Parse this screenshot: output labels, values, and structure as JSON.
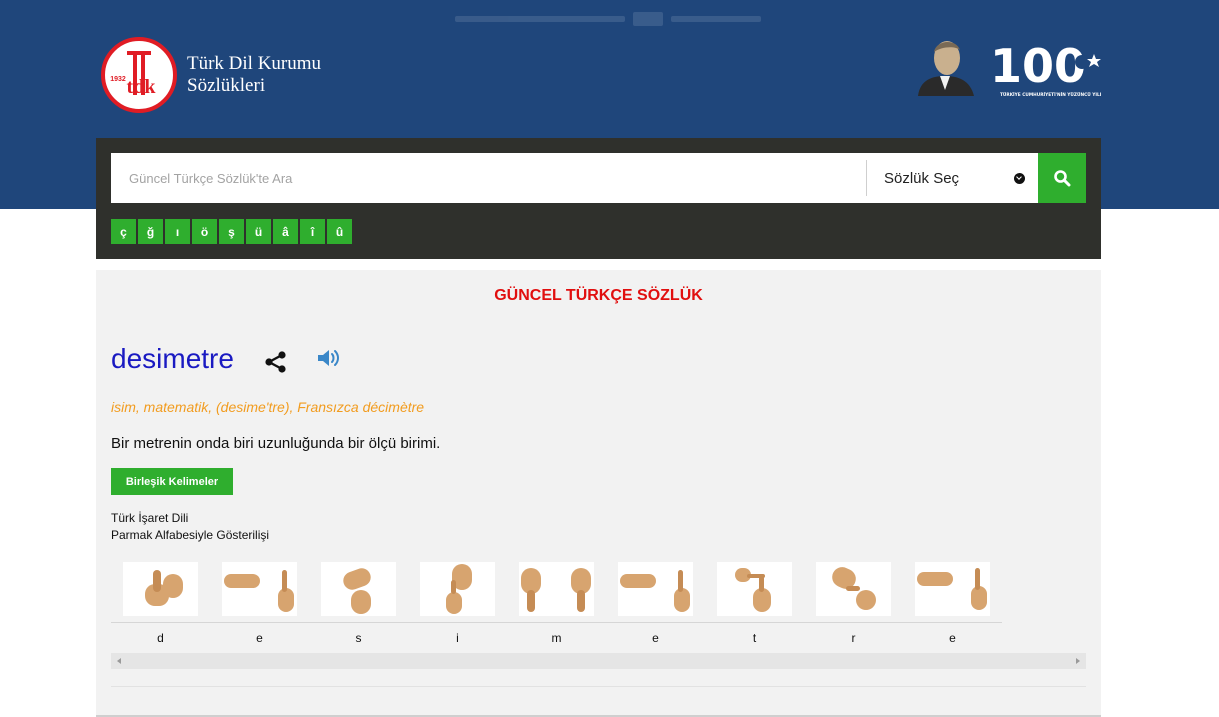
{
  "brand": {
    "name_line1": "Türk Dil Kurumu",
    "name_line2": "Sözlükleri",
    "logo_year": "1932",
    "logo_letters": "tdk",
    "centenary_number": "100",
    "centenary_caption": "TÜRKİYE CUMHURİYETİ'NİN YÜZÜNCÜ YILI"
  },
  "search": {
    "placeholder": "Güncel Türkçe Sözlük'te Ara",
    "select_label": "Sözlük Seç",
    "letters": [
      "ç",
      "ğ",
      "ı",
      "ö",
      "ş",
      "ü",
      "â",
      "î",
      "û"
    ]
  },
  "entry": {
    "dictionary_title": "GÜNCEL TÜRKÇE SÖZLÜK",
    "word": "desimetre",
    "meta": "isim, matematik, (desime'tre), Fransızca décimètre",
    "definition": "Bir metrenin onda biri uzunluğunda bir ölçü birimi.",
    "compound_button": "Birleşik Kelimeler",
    "sign_title_line1": "Türk İşaret Dili",
    "sign_title_line2": "Parmak Alfabesiyle Gösterilişi",
    "sign_letters": [
      "d",
      "e",
      "s",
      "i",
      "m",
      "e",
      "t",
      "r",
      "e"
    ]
  },
  "colors": {
    "header_bg": "#1f467b",
    "accent_green": "#2fae2e",
    "title_red": "#e10f0f",
    "word_blue": "#1a1ac2",
    "meta_orange": "#f29c1f"
  },
  "icons": [
    "share-icon",
    "speaker-icon",
    "search-icon",
    "chevron-down-icon"
  ]
}
